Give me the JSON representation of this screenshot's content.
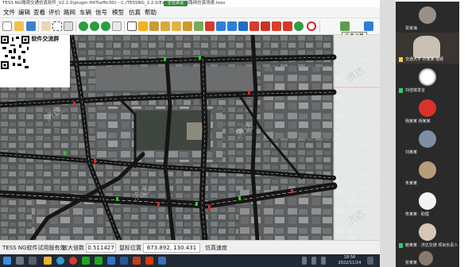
{
  "window": {
    "title": "TESS NG微观交通仿真软件_V2.2.0(plugin:HitTraffic3D) - C:/TESSNG_2.2.0/Example/杭州路网仿真场景.tess",
    "meeting_badge": "正在讲话"
  },
  "menu": [
    "文件",
    "编辑",
    "查看",
    "评价",
    "路网",
    "车辆",
    "信号",
    "模型",
    "仿真",
    "帮助"
  ],
  "toolbar": {
    "icons": [
      "new-file-icon",
      "open-folder-icon",
      "save-icon",
      "hand-pan-icon",
      "selection-icon",
      "mouse-icon",
      "zoom-in-icon",
      "zoom-out-icon",
      "fit-view-icon",
      "grid-icon",
      "pointer-icon",
      "draw-link-icon",
      "connector-icon",
      "area-icon",
      "route-icon",
      "detector-icon",
      "signal-icon",
      "parking-icon",
      "bus-line-icon",
      "bus-stop-icon",
      "camera-icon",
      "delete-icon",
      "decision-icon",
      "speed-limit-icon",
      "settings-icon",
      "run-icon",
      "pause-icon"
    ],
    "tooltip": "仿真运算"
  },
  "map": {
    "qr_title": "企业公众号  软件交流群",
    "watermark": "济达"
  },
  "status": {
    "trial_text": "TESS NG软件试用版有效",
    "zoom_label": "放大倍数",
    "zoom_value": "0.511427",
    "coord_label": "鼠标位置",
    "coord_value": "673.892, 130.431",
    "speed_label": "仿真速度"
  },
  "taskbar": {
    "time": "18:56",
    "date": "2022/11/24"
  },
  "participants": [
    {
      "name": "贾家海",
      "kind": "photo"
    },
    {
      "name": "交通大学 孙某某 视频",
      "kind": "camera"
    },
    {
      "name": "刘佳琪发言",
      "kind": "avatar"
    },
    {
      "name": "杨某某 杨某某",
      "kind": "red-badge"
    },
    {
      "name": "刘某某",
      "kind": "photo"
    },
    {
      "name": "朱某某",
      "kind": "photo"
    },
    {
      "name": "佟某某 · 助理",
      "kind": "scribble"
    },
    {
      "name": "鲍某某 · 济达交通 项目负责人",
      "kind": "photo"
    },
    {
      "name": "张某某",
      "kind": "photo"
    }
  ],
  "colors": {
    "road": "#151515",
    "lane_line": "#d8d8d8",
    "signal_red": "#ff2020",
    "signal_green": "#21d421",
    "meeting_green": "#2e8b3e"
  }
}
